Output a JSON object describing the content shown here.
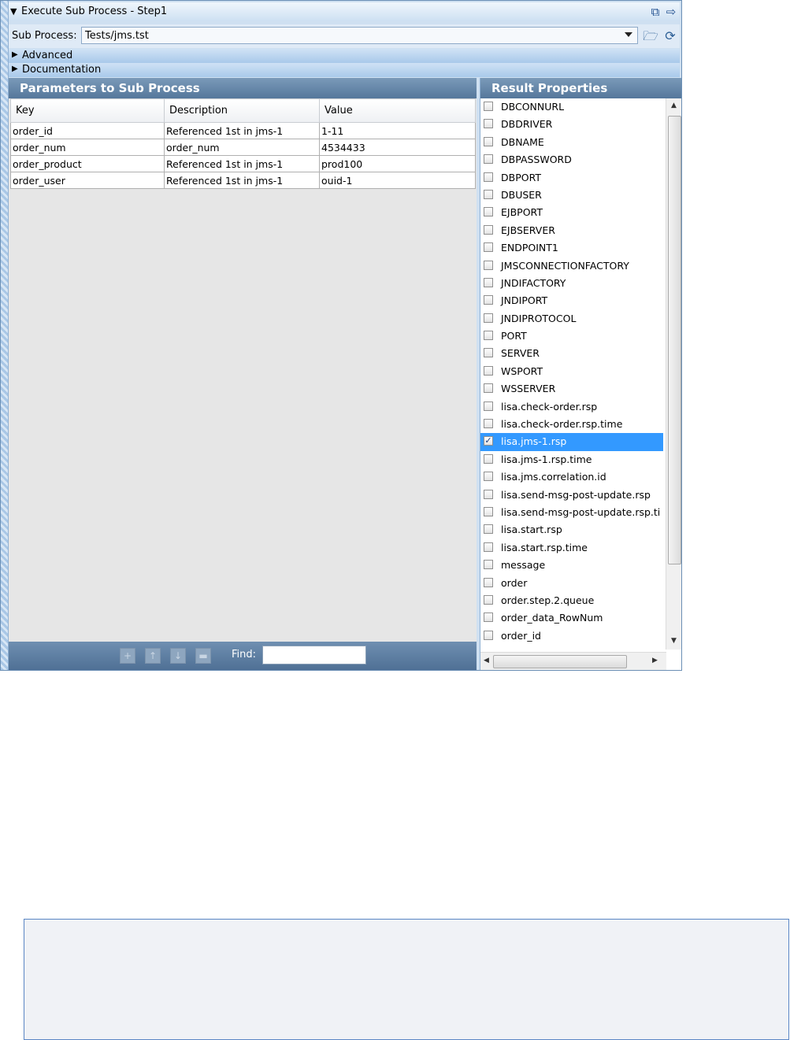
{
  "window": {
    "title": "Execute Sub Process - Step1"
  },
  "subprocess": {
    "label": "Sub Process:",
    "value": "Tests/jms.tst"
  },
  "sections": {
    "advanced": "Advanced",
    "documentation": "Documentation"
  },
  "params": {
    "header": "Parameters to Sub Process",
    "columns": [
      "Key",
      "Description",
      "Value"
    ],
    "rows": [
      [
        "order_id",
        "Referenced 1st in jms-1",
        "1-11"
      ],
      [
        "order_num",
        "order_num",
        "4534433"
      ],
      [
        "order_product",
        "Referenced 1st in jms-1",
        "prod100"
      ],
      [
        "order_user",
        "Referenced 1st in jms-1",
        "ouid-1"
      ]
    ],
    "find_label": "Find:",
    "find_value": ""
  },
  "results": {
    "header": "Result Properties",
    "items": [
      {
        "label": "DBCONNURL",
        "checked": false
      },
      {
        "label": "DBDRIVER",
        "checked": false
      },
      {
        "label": "DBNAME",
        "checked": false
      },
      {
        "label": "DBPASSWORD",
        "checked": false
      },
      {
        "label": "DBPORT",
        "checked": false
      },
      {
        "label": "DBUSER",
        "checked": false
      },
      {
        "label": "EJBPORT",
        "checked": false
      },
      {
        "label": "EJBSERVER",
        "checked": false
      },
      {
        "label": "ENDPOINT1",
        "checked": false
      },
      {
        "label": "JMSCONNECTIONFACTORY",
        "checked": false
      },
      {
        "label": "JNDIFACTORY",
        "checked": false
      },
      {
        "label": "JNDIPORT",
        "checked": false
      },
      {
        "label": "JNDIPROTOCOL",
        "checked": false
      },
      {
        "label": "PORT",
        "checked": false
      },
      {
        "label": "SERVER",
        "checked": false
      },
      {
        "label": "WSPORT",
        "checked": false
      },
      {
        "label": "WSSERVER",
        "checked": false
      },
      {
        "label": "lisa.check-order.rsp",
        "checked": false
      },
      {
        "label": "lisa.check-order.rsp.time",
        "checked": false
      },
      {
        "label": "lisa.jms-1.rsp",
        "checked": true,
        "selected": true
      },
      {
        "label": "lisa.jms-1.rsp.time",
        "checked": false
      },
      {
        "label": "lisa.jms.correlation.id",
        "checked": false
      },
      {
        "label": "lisa.send-msg-post-update.rsp",
        "checked": false
      },
      {
        "label": "lisa.send-msg-post-update.rsp.ti",
        "checked": false
      },
      {
        "label": "lisa.start.rsp",
        "checked": false
      },
      {
        "label": "lisa.start.rsp.time",
        "checked": false
      },
      {
        "label": "message",
        "checked": false
      },
      {
        "label": "order",
        "checked": false
      },
      {
        "label": "order.step.2.queue",
        "checked": false
      },
      {
        "label": "order_data_RowNum",
        "checked": false
      },
      {
        "label": "order_id",
        "checked": false
      }
    ]
  },
  "icons": {
    "title_left": "undock-icon",
    "title_right": "arrow-right-icon",
    "open": "open-folder-icon",
    "refresh": "refresh-icon",
    "add": "add-icon",
    "up": "move-up-icon",
    "down": "move-down-icon",
    "delete": "delete-icon"
  },
  "colors": {
    "header_bg": "#55779b",
    "selection": "#3399ff",
    "panel_bg": "#cfe0f1"
  }
}
